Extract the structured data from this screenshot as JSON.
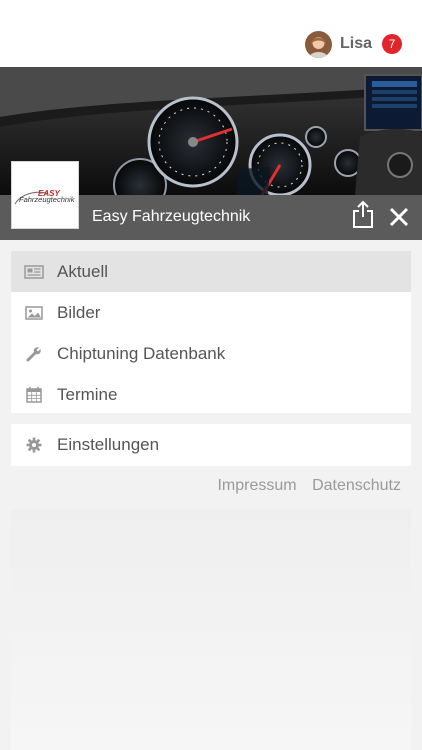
{
  "header": {
    "user_name": "Lisa",
    "notification_count": "7"
  },
  "brand": {
    "name": "Easy Fahrzeugtechnik",
    "logo_text_top": "EASY",
    "logo_text_bottom": "Fahrzeugtechnik"
  },
  "menu": {
    "items": [
      {
        "label": "Aktuell",
        "icon": "newspaper-icon",
        "active": true
      },
      {
        "label": "Bilder",
        "icon": "image-icon",
        "active": false
      },
      {
        "label": "Chiptuning Datenbank",
        "icon": "wrench-icon",
        "active": false
      },
      {
        "label": "Termine",
        "icon": "calendar-icon",
        "active": false
      }
    ],
    "settings_label": "Einstellungen"
  },
  "footer": {
    "impressum": "Impressum",
    "datenschutz": "Datenschutz"
  },
  "colors": {
    "badge": "#e0262a",
    "brand_bar": "#5b5b5b",
    "active_item": "#e3e3e3",
    "background": "#f2f2f2"
  }
}
